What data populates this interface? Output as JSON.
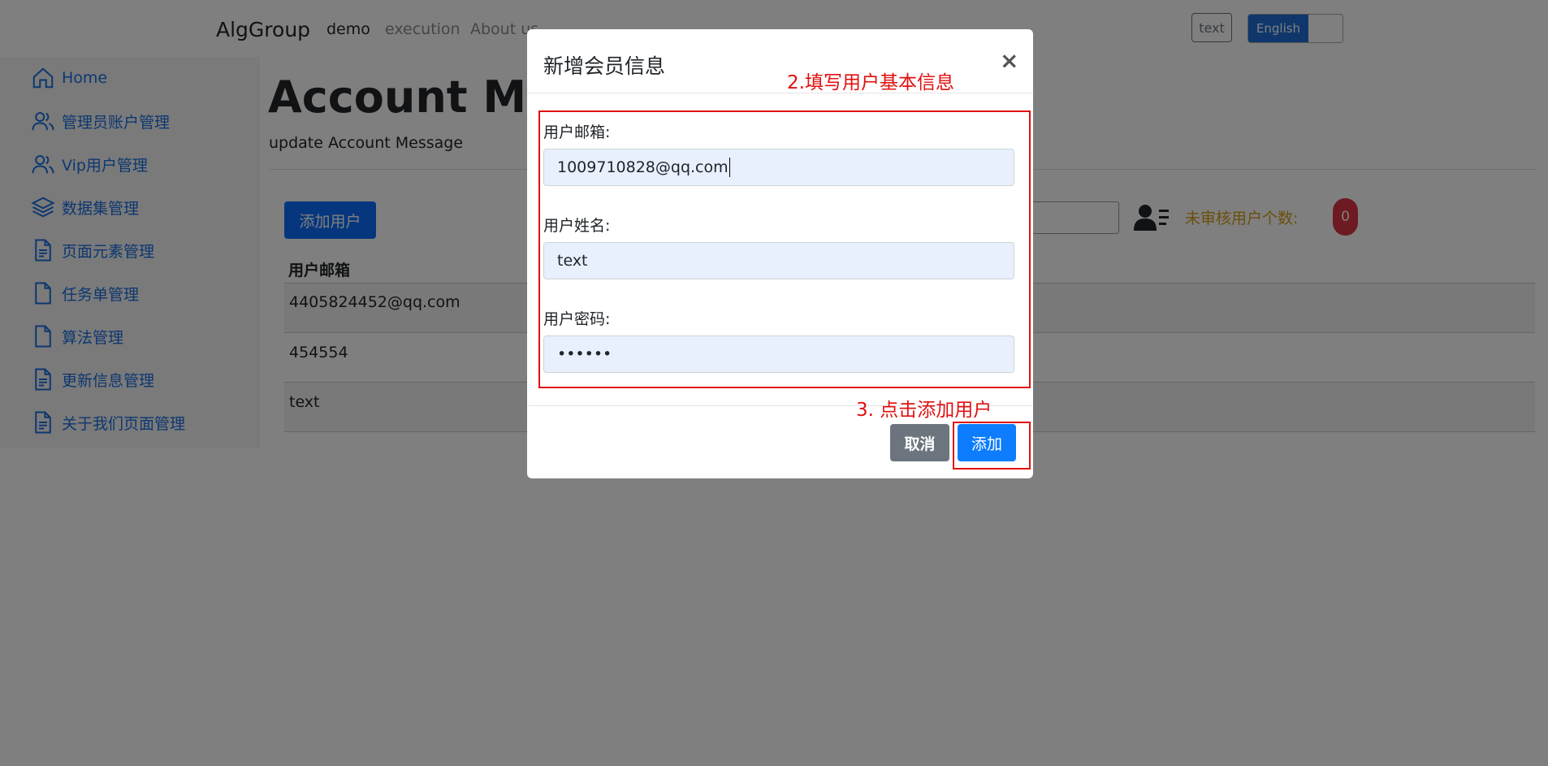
{
  "navbar": {
    "brand": "AlgGroup",
    "links": [
      "demo",
      "execution",
      "About us"
    ],
    "text_button": "text",
    "language_toggle": "English"
  },
  "sidebar": {
    "items": [
      {
        "label": "Home",
        "icon": "home-icon"
      },
      {
        "label": "管理员账户管理",
        "icon": "users-icon"
      },
      {
        "label": "Vip用户管理",
        "icon": "users-icon"
      },
      {
        "label": "数据集管理",
        "icon": "layers-icon"
      },
      {
        "label": "页面元素管理",
        "icon": "document-icon"
      },
      {
        "label": "任务单管理",
        "icon": "file-icon"
      },
      {
        "label": "算法管理",
        "icon": "file-icon"
      },
      {
        "label": "更新信息管理",
        "icon": "document-icon"
      },
      {
        "label": "关于我们页面管理",
        "icon": "document-icon"
      }
    ]
  },
  "main": {
    "title": "Account Mana",
    "subtitle": "update Account Message",
    "add_user_button": "添加用户",
    "pending_label": "未审核用户个数:",
    "pending_count": "0",
    "table": {
      "header": "用户邮箱",
      "rows": [
        "4405824452@qq.com",
        "454554",
        "text"
      ]
    }
  },
  "modal": {
    "title": "新增会员信息",
    "close": "×",
    "email_label": "用户邮箱:",
    "email_value": "1009710828@qq.com",
    "name_label": "用户姓名:",
    "name_value": "text",
    "password_label": "用户密码:",
    "password_value": "••••••",
    "cancel_button": "取消",
    "confirm_button": "添加"
  },
  "annotations": {
    "step2": "2.填写用户基本信息",
    "step3": "3. 点击添加用户"
  },
  "colors": {
    "primary": "#0d6efd",
    "annotation": "#e01010",
    "sidebar_link": "#1a6ee0",
    "badge": "#dc3545"
  }
}
